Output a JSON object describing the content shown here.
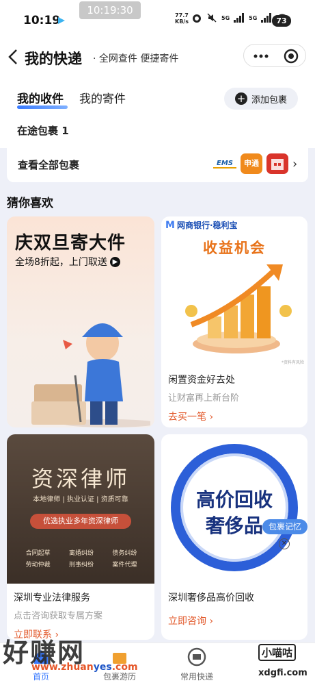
{
  "status": {
    "time": "10:19",
    "clock_overlay": "10:19:30",
    "net_speed_value": "77.7",
    "net_speed_unit": "KB/s",
    "battery": "73",
    "signal1": "5G",
    "signal2": "5G"
  },
  "header": {
    "title": "我的快递",
    "subtitle": "· 全网查件 便捷寄件"
  },
  "tabs": {
    "received": "我的收件",
    "sent": "我的寄件",
    "add": "添加包裹",
    "in_transit": "在途包裹 1"
  },
  "view_all": {
    "label": "查看全部包裹",
    "logo_ems": "EMS",
    "logo_sto": "申通"
  },
  "guess": {
    "title": "猜你喜欢"
  },
  "cards": {
    "c1": {
      "title": "庆双旦寄大件",
      "sub": "全场8折起，上门取送"
    },
    "c2": {
      "bank": "网商银行·稳利宝",
      "hero": "收益机会",
      "title": "闲置资金好去处",
      "sub": "让财富再上新台阶",
      "link": "去买一笔 ›",
      "note": "*资料有风险"
    },
    "c3": {
      "hero": "资深律师",
      "tags": "本地律师 | 执业认证 | 资质可靠",
      "button": "优选执业多年资深律师",
      "grid": [
        "合同起草",
        "离婚纠纷",
        "债务纠纷",
        "劳动仲裁",
        "刑事纠纷",
        "案件代理"
      ],
      "title": "深圳专业法律服务",
      "sub": "点击咨询获取专属方案",
      "link": "立即联系 ›"
    },
    "c4": {
      "hero1": "高价回收",
      "hero2": "奢侈品",
      "badge": "包裹记忆",
      "title": "深圳奢侈品高价回收",
      "link": "立即咨询 ›"
    }
  },
  "nav": {
    "home": "首页",
    "trip": "包裹游历",
    "express": "常用快递"
  },
  "watermark": {
    "cn": "好赚网",
    "url_a": "www.zhuan",
    "url_b": "yes",
    "url_c": ".com",
    "right": "小喵咕",
    "right_url": "xdgfi.com"
  },
  "colors": {
    "accent": "#3a7bff",
    "link_orange": "#e2582a",
    "brand_blue": "#18327e"
  }
}
